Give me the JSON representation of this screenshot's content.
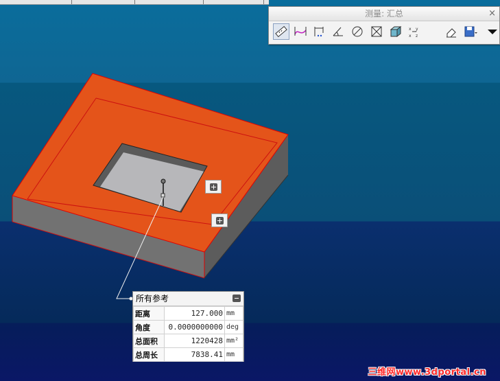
{
  "measure_panel": {
    "title": "测量: 汇总",
    "close_glyph": "×",
    "tools": [
      {
        "icon": "ruler-icon",
        "active": true
      },
      {
        "icon": "length-icon"
      },
      {
        "icon": "distance-icon"
      },
      {
        "icon": "angle-icon"
      },
      {
        "icon": "diameter-icon"
      },
      {
        "icon": "area-icon"
      },
      {
        "icon": "volume-icon"
      },
      {
        "icon": "transform-icon"
      },
      {
        "icon": "eraser-icon"
      },
      {
        "icon": "save-icon"
      },
      {
        "icon": "dropdown-arrow-icon"
      }
    ]
  },
  "refs_panel": {
    "title": "所有参考",
    "rows": [
      {
        "label": "距离",
        "value": "127.000",
        "unit": "mm"
      },
      {
        "label": "角度",
        "value": "0.0000000000",
        "unit": "deg"
      },
      {
        "label": "总面积",
        "value": "1220428",
        "unit": "mm²"
      },
      {
        "label": "总周长",
        "value": "7838.41",
        "unit": "mm"
      }
    ]
  },
  "watermark": "三维网www.3dportal.cn",
  "colors": {
    "part_top": "#e4541a",
    "part_side": "#6f6f6f",
    "hole_floor": "#b5b5b8",
    "edge_highlight": "#e00000"
  }
}
